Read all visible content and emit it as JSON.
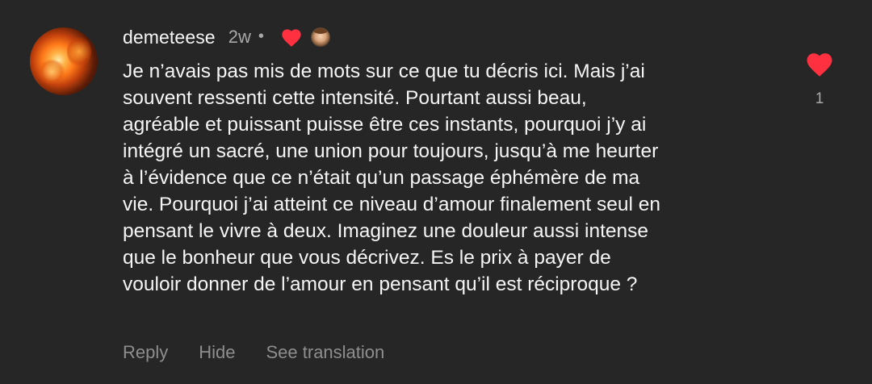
{
  "comment": {
    "username": "demeteese",
    "time": "2w",
    "separator": "•",
    "text": "Je n’avais pas mis de mots sur ce que tu décris ici. Mais j’ai\nsouvent ressenti cette intensité. Pourtant aussi beau,\nagréable et puissant puisse être ces instants, pourquoi j’y ai\nintégré un sacré, une union pour toujours, jusqu’à me heurter\nà l’évidence que ce n’était qu’un passage éphémère de ma\nvie. Pourquoi j’ai atteint ce niveau d’amour finalement seul en\npensant le vivre à deux. Imaginez une douleur aussi intense\nque le bonheur que vous décrivez. Es le prix à payer de\nvouloir donner de l’amour en pensant qu’il est réciproque ?",
    "like_count": "1",
    "actions": {
      "reply": "Reply",
      "hide": "Hide",
      "see_translation": "See translation"
    }
  },
  "icons": {
    "author_liked_heart": "heart-icon",
    "like_heart": "heart-icon",
    "avatar": "fire-photo-avatar",
    "author_avatar": "author-mini-avatar"
  },
  "colors": {
    "background": "#262626",
    "text": "#f5f5f5",
    "muted": "#a8a8a8",
    "heart": "#ff3040"
  }
}
